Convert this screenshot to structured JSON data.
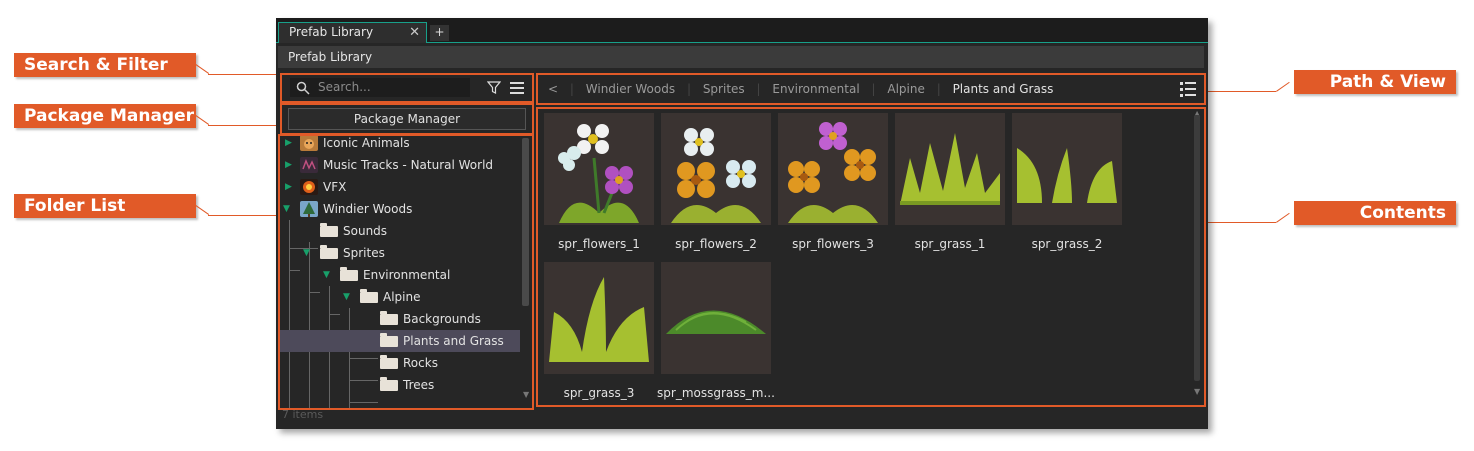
{
  "callouts": {
    "search_filter": "Search & Filter",
    "package_manager": "Package Manager",
    "folder_list": "Folder List",
    "path_view": "Path & View",
    "contents": "Contents"
  },
  "accent_color": "#e15a28",
  "tab": {
    "label": "Prefab Library",
    "close": "✕",
    "new": "+"
  },
  "titlebar": "Prefab Library",
  "search": {
    "placeholder": "Search...",
    "icon": "search-icon",
    "filter_icon": "filter-icon",
    "menu_icon": "menu-icon"
  },
  "package_manager_button": "Package Manager",
  "folders": {
    "items": [
      {
        "label": "Iconic Animals"
      },
      {
        "label": "Music Tracks - Natural World"
      },
      {
        "label": "VFX"
      },
      {
        "label": "Windier Woods"
      },
      {
        "label": "Sounds"
      },
      {
        "label": "Sprites"
      },
      {
        "label": "Environmental"
      },
      {
        "label": "Alpine"
      },
      {
        "label": "Backgrounds"
      },
      {
        "label": "Plants and Grass"
      },
      {
        "label": "Rocks"
      },
      {
        "label": "Trees"
      }
    ],
    "status": "7 items"
  },
  "path": {
    "back": "<",
    "crumbs": [
      "Windier Woods",
      "Sprites",
      "Environmental",
      "Alpine",
      "Plants and Grass"
    ],
    "separator": "|"
  },
  "contents": {
    "items": [
      {
        "name": "spr_flowers_1"
      },
      {
        "name": "spr_flowers_2"
      },
      {
        "name": "spr_flowers_3"
      },
      {
        "name": "spr_grass_1"
      },
      {
        "name": "spr_grass_2"
      },
      {
        "name": "spr_grass_3"
      },
      {
        "name": "spr_mossgrass_m..."
      }
    ]
  }
}
